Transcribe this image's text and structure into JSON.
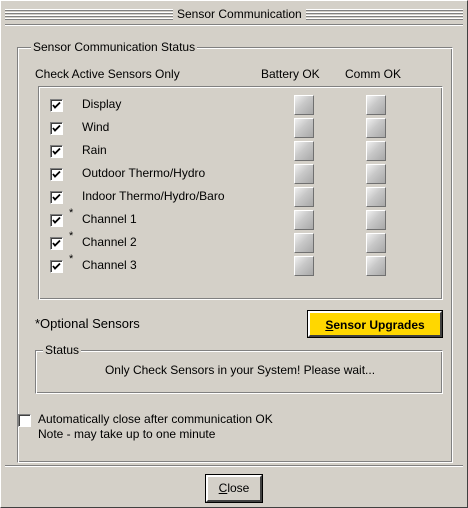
{
  "window": {
    "title": "Sensor Communication"
  },
  "status_group": {
    "legend": "Sensor Communication Status",
    "check_header": "Check Active Sensors Only",
    "battery_header": "Battery OK",
    "comm_header": "Comm OK",
    "sensors": [
      {
        "label": "Display",
        "checked": true,
        "optional": false,
        "battery_ok": false,
        "comm_ok": false
      },
      {
        "label": "Wind",
        "checked": true,
        "optional": false,
        "battery_ok": false,
        "comm_ok": false
      },
      {
        "label": "Rain",
        "checked": true,
        "optional": false,
        "battery_ok": false,
        "comm_ok": false
      },
      {
        "label": "Outdoor Thermo/Hydro",
        "checked": true,
        "optional": false,
        "battery_ok": false,
        "comm_ok": false
      },
      {
        "label": "Indoor Thermo/Hydro/Baro",
        "checked": true,
        "optional": false,
        "battery_ok": false,
        "comm_ok": false
      },
      {
        "label": "Channel 1",
        "checked": true,
        "optional": true,
        "battery_ok": false,
        "comm_ok": false
      },
      {
        "label": "Channel 2",
        "checked": true,
        "optional": true,
        "battery_ok": false,
        "comm_ok": false
      },
      {
        "label": "Channel 3",
        "checked": true,
        "optional": true,
        "battery_ok": false,
        "comm_ok": false
      }
    ],
    "optional_asterisk": "*",
    "optional_note": "*Optional Sensors",
    "upgrades_button": {
      "accel": "S",
      "rest": "ensor Upgrades"
    },
    "status": {
      "legend": "Status",
      "message": "Only Check Sensors in your System! Please wait..."
    }
  },
  "auto_close": {
    "checked": false,
    "label_line1": "Automatically close after communication OK",
    "label_line2": "Note - may take up to one minute"
  },
  "close_button": {
    "accel": "C",
    "rest": "lose"
  },
  "colors": {
    "window_bg": "#d4d0c8",
    "upgrade_button_bg": "#ffd700"
  }
}
